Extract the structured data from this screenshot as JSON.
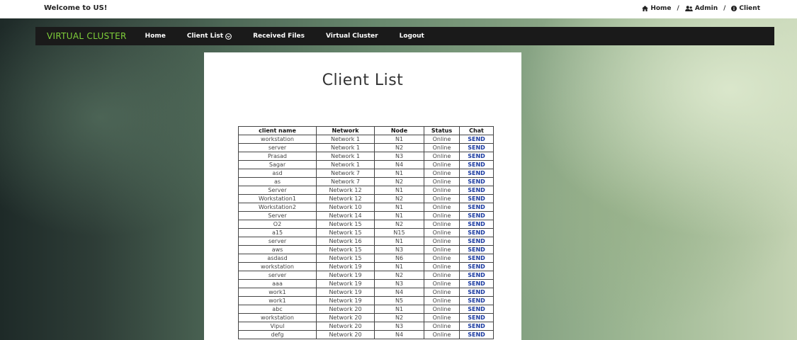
{
  "header": {
    "welcome": "Welcome to US!",
    "breadcrumbs": [
      {
        "label": "Home",
        "icon": "home-icon"
      },
      {
        "label": "Admin",
        "icon": "users-icon"
      },
      {
        "label": "Client",
        "icon": "info-icon"
      }
    ],
    "separator": "/"
  },
  "navbar": {
    "brand": "VIRTUAL CLUSTER",
    "brand_color": "#7fcf3a",
    "items": [
      "Home",
      "Client List",
      "Received Files",
      "Virtual Cluster",
      "Logout"
    ]
  },
  "main": {
    "title": "Client List",
    "columns": [
      "client name",
      "Network",
      "Node",
      "Status",
      "Chat"
    ],
    "rows": [
      [
        "workstation",
        "Network 1",
        "N1",
        "Online",
        "SEND"
      ],
      [
        "server",
        "Network 1",
        "N2",
        "Online",
        "SEND"
      ],
      [
        "Prasad",
        "Network 1",
        "N3",
        "Online",
        "SEND"
      ],
      [
        "Sagar",
        "Network 1",
        "N4",
        "Online",
        "SEND"
      ],
      [
        "asd",
        "Network 7",
        "N1",
        "Online",
        "SEND"
      ],
      [
        "as",
        "Network 7",
        "N2",
        "Online",
        "SEND"
      ],
      [
        "Server",
        "Network 12",
        "N1",
        "Online",
        "SEND"
      ],
      [
        "Workstation1",
        "Network 12",
        "N2",
        "Online",
        "SEND"
      ],
      [
        "Workstation2",
        "Network 10",
        "N1",
        "Online",
        "SEND"
      ],
      [
        "Server",
        "Network 14",
        "N1",
        "Online",
        "SEND"
      ],
      [
        "O2",
        "Network 15",
        "N2",
        "Online",
        "SEND"
      ],
      [
        "a15",
        "Network 15",
        "N15",
        "Online",
        "SEND"
      ],
      [
        "server",
        "Network 16",
        "N1",
        "Online",
        "SEND"
      ],
      [
        "aws",
        "Network 15",
        "N3",
        "Online",
        "SEND"
      ],
      [
        "asdasd",
        "Network 15",
        "N6",
        "Online",
        "SEND"
      ],
      [
        "workstation",
        "Network 19",
        "N1",
        "Online",
        "SEND"
      ],
      [
        "server",
        "Network 19",
        "N2",
        "Online",
        "SEND"
      ],
      [
        "aaa",
        "Network 19",
        "N3",
        "Online",
        "SEND"
      ],
      [
        "work1",
        "Network 19",
        "N4",
        "Online",
        "SEND"
      ],
      [
        "work1",
        "Network 19",
        "N5",
        "Online",
        "SEND"
      ],
      [
        "abc",
        "Network 20",
        "N1",
        "Online",
        "SEND"
      ],
      [
        "workstation",
        "Network 20",
        "N2",
        "Online",
        "SEND"
      ],
      [
        "Vipul",
        "Network 20",
        "N3",
        "Online",
        "SEND"
      ],
      [
        "defg",
        "Network 20",
        "N4",
        "Online",
        "SEND"
      ]
    ]
  }
}
